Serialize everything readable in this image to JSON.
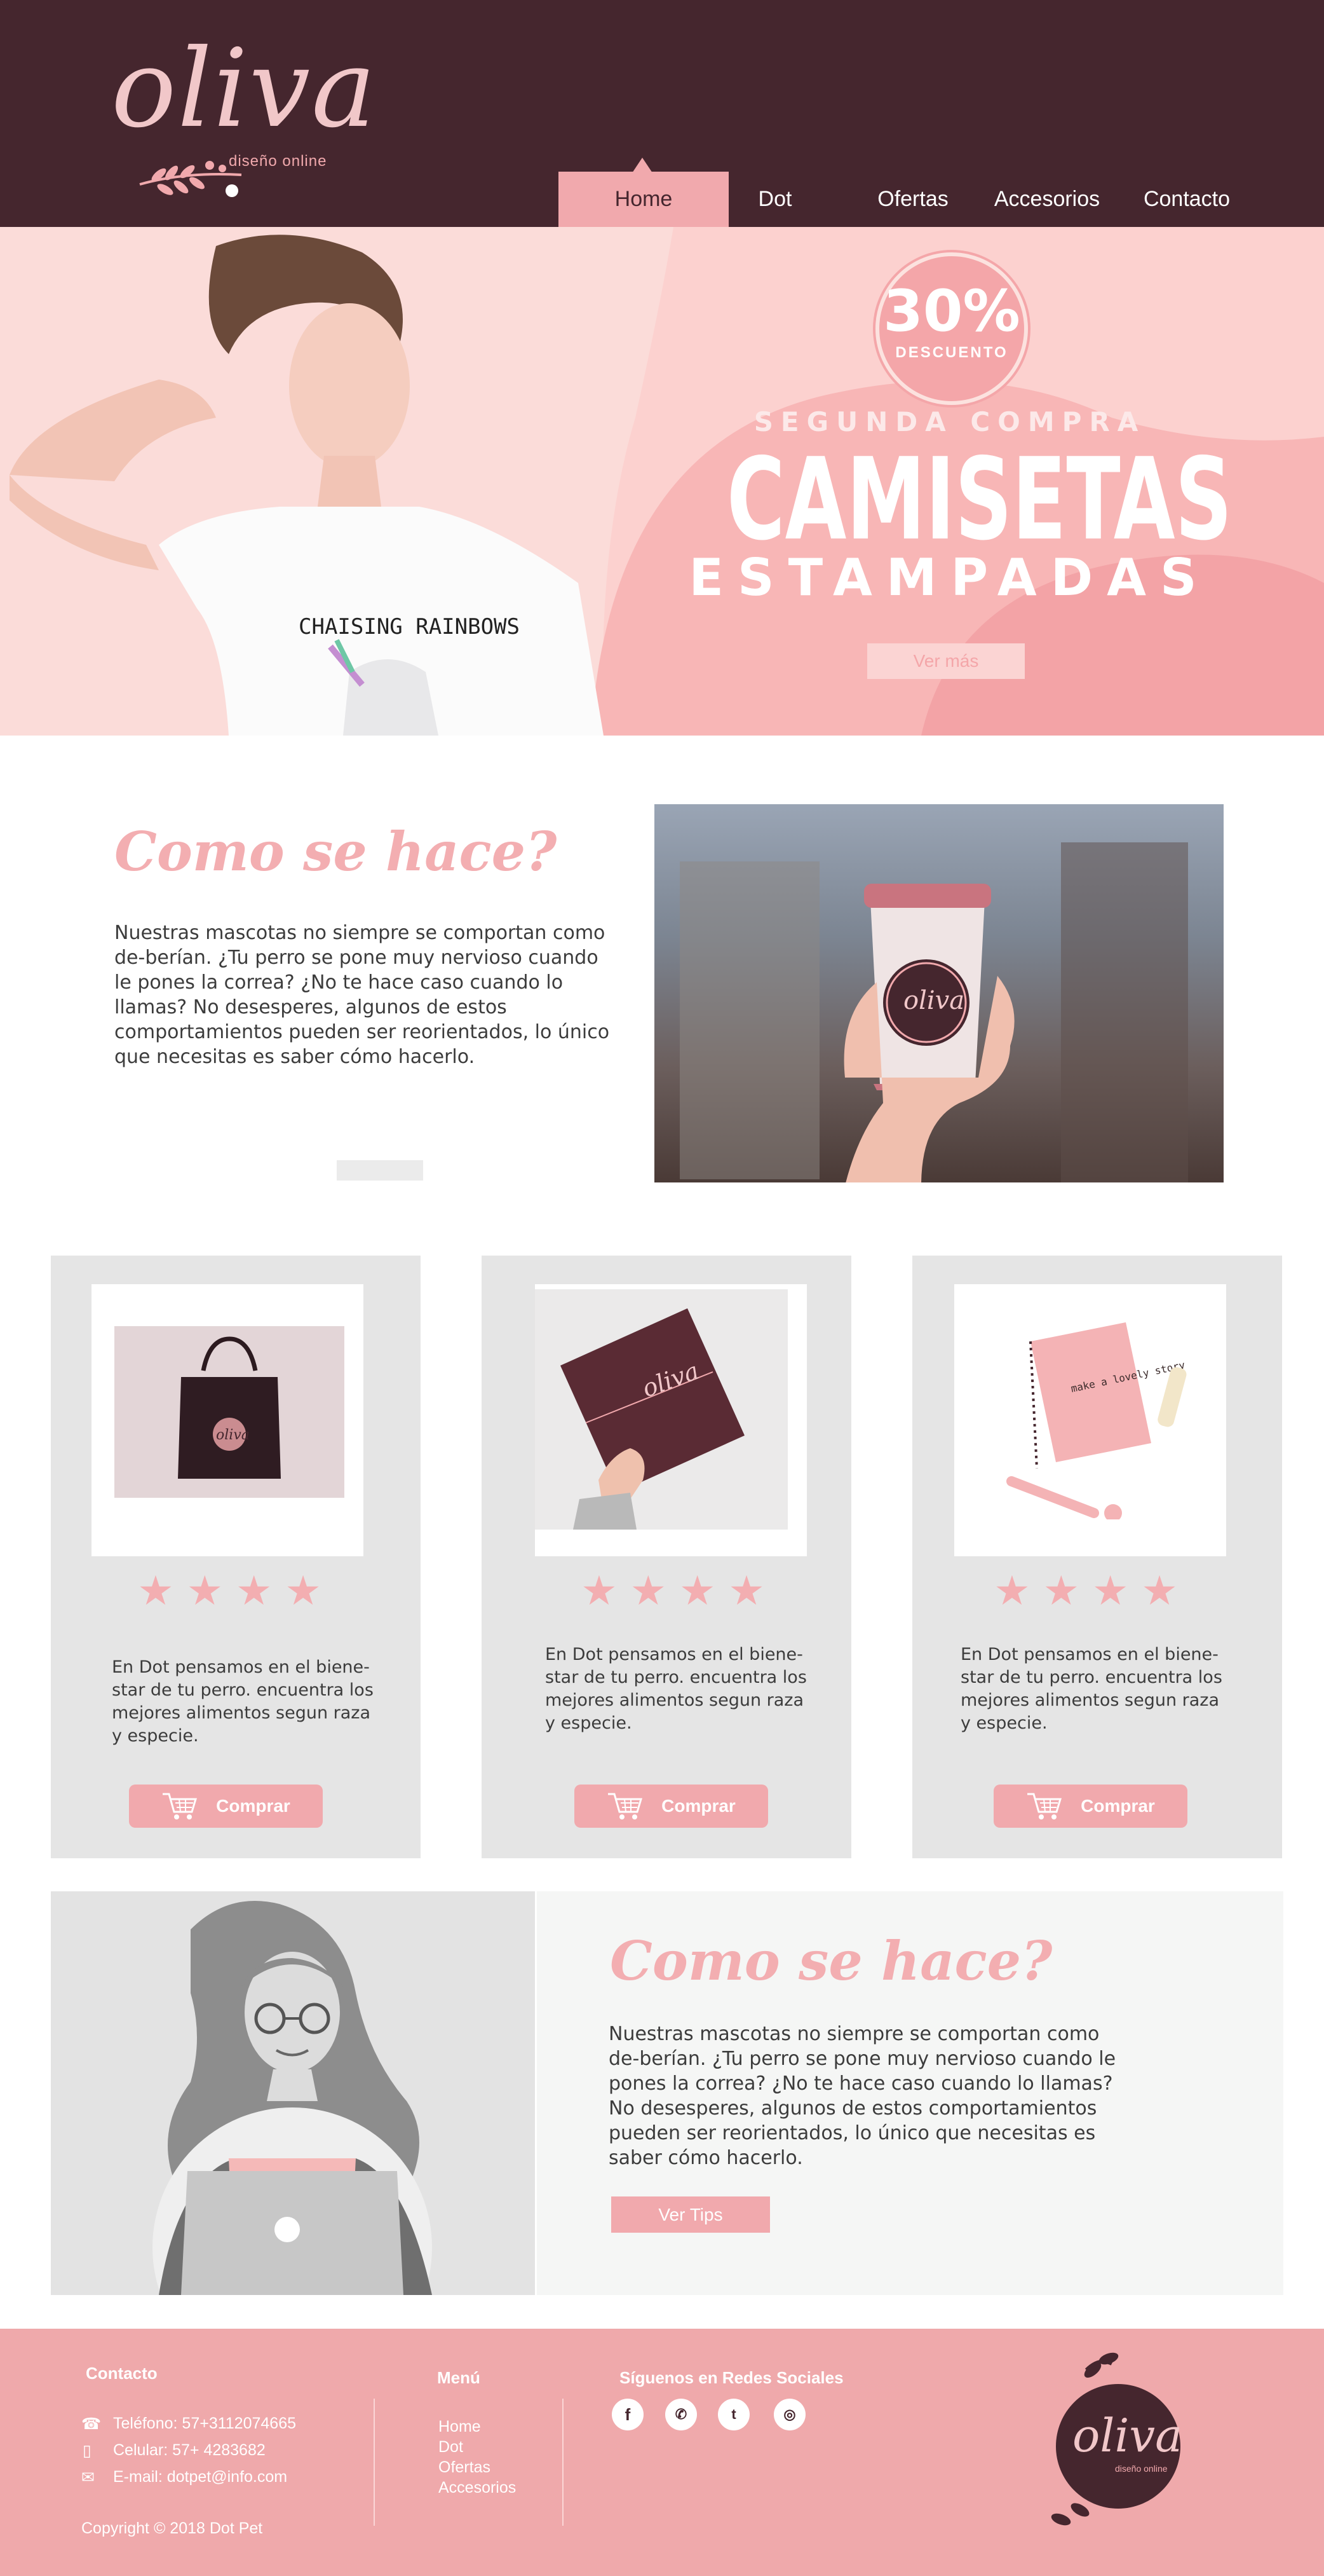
{
  "brand": {
    "name": "oliva",
    "tagline": "diseño online"
  },
  "nav": {
    "items": [
      "Home",
      "Dot",
      "Ofertas",
      "Accesorios",
      "Contacto"
    ],
    "active": "Home"
  },
  "hero": {
    "badge_value": "30%",
    "badge_label": "DESCUENTO",
    "line1": "SEGUNDA COMPRA",
    "line2": "CAMISETAS",
    "line3": "ESTAMPADAS",
    "shirt_text": "CHAISING RAINBOWS",
    "button": "Ver más"
  },
  "como": {
    "title": "Como se hace?",
    "body": "Nuestras mascotas no siempre se comportan como de-berían. ¿Tu perro se pone muy nervioso cuando le pones la correa? ¿No te hace caso cuando lo llamas? No desesperes, algunos de estos comportamientos pueden ser reorientados, lo único que necesitas es saber cómo hacerlo.",
    "cup_logo": "oliva"
  },
  "products": [
    {
      "rating": 4,
      "text": "En Dot pensamos en el biene-star de tu perro. encuentra los mejores alimentos segun raza y especie.",
      "button": "Comprar",
      "item_logo": "oliva"
    },
    {
      "rating": 4,
      "text": "En Dot pensamos en el biene-star de tu perro. encuentra los mejores alimentos segun raza y especie.",
      "button": "Comprar",
      "item_logo": "oliva"
    },
    {
      "rating": 4,
      "text": "En Dot pensamos en el biene-star de tu perro. encuentra los mejores alimentos segun raza y especie.",
      "button": "Comprar",
      "item_logo": "make a lovely story"
    }
  ],
  "tips": {
    "title": "Como se hace?",
    "body": "Nuestras mascotas no siempre se comportan como de-berían. ¿Tu perro se pone muy nervioso cuando le pones la correa? ¿No te hace caso cuando lo llamas? No desesperes, algunos de estos comportamientos pueden ser reorientados, lo único que necesitas es saber cómo hacerlo.",
    "button": "Ver Tips"
  },
  "footer": {
    "contact_title": "Contacto",
    "phone": "Teléfono: 57+3112074665",
    "mobile": "Celular: 57+ 4283682",
    "email": "E-mail: dotpet@info.com",
    "copyright": "Copyright  © 2018 Dot Pet",
    "menu_title": "Menú",
    "menu_items": [
      "Home",
      "Dot",
      "Ofertas",
      "Accesorios"
    ],
    "social_title": "Síguenos en Redes Sociales",
    "social_icons": [
      "facebook-icon",
      "whatsapp-icon",
      "twitter-icon",
      "instagram-icon"
    ],
    "logo_name": "oliva",
    "logo_tagline": "diseño online"
  },
  "colors": {
    "dark": "#45262e",
    "pink": "#f1a9ad",
    "light_pink": "#fbdcd9",
    "grey": "#e5e5e5"
  }
}
